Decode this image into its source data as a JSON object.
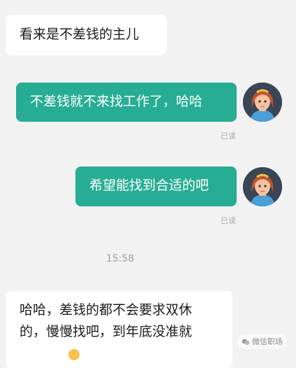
{
  "messages": [
    {
      "side": "left",
      "text": "看来是不差钱的主儿"
    },
    {
      "side": "right",
      "text": "不差钱就不来找工作了，哈哈",
      "status": "已读"
    },
    {
      "side": "right",
      "text": "希望能找到合适的吧",
      "status": "已读"
    }
  ],
  "timestamp": "15:58",
  "last_message": {
    "lines": [
      "哈哈，差钱的都不会要求双休",
      "的，慢慢找吧，到年底没准就"
    ]
  },
  "watermark": "微信职场",
  "icons": {
    "avatar": "cartoon-woman-avatar",
    "watermark": "wechat-icon",
    "emoji": "emoji-icon"
  },
  "colors": {
    "sent_bubble": "#27ad94",
    "received_bubble": "#ffffff",
    "background": "#f2f2f2"
  }
}
